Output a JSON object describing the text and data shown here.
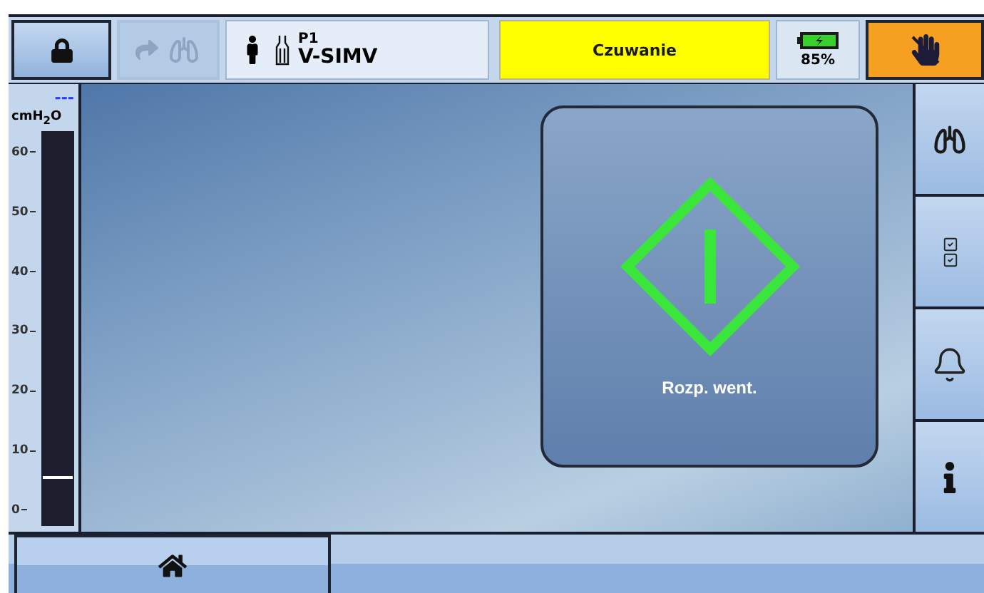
{
  "top_bar": {
    "breath_button": {
      "disabled": true
    },
    "patient": {
      "name": "P1",
      "mode": "V-SIMV"
    },
    "status": {
      "text": "Czuwanie"
    },
    "battery": {
      "reading": "85%"
    }
  },
  "pressure_gauge": {
    "value": "---",
    "unit": "cmH$_{2}$O",
    "ticks": [
      "60",
      "50",
      "40",
      "30",
      "20",
      "10",
      "0"
    ],
    "level": 0.12
  },
  "start_card": {
    "label": "Rozp. went."
  },
  "side_buttons": [
    {
      "kind": "lungs"
    },
    {
      "kind": "checklist"
    },
    {
      "kind": "alarm"
    },
    {
      "kind": "info"
    }
  ],
  "bottom_bar": {
    "home_button": {
      "selected": true
    }
  }
}
